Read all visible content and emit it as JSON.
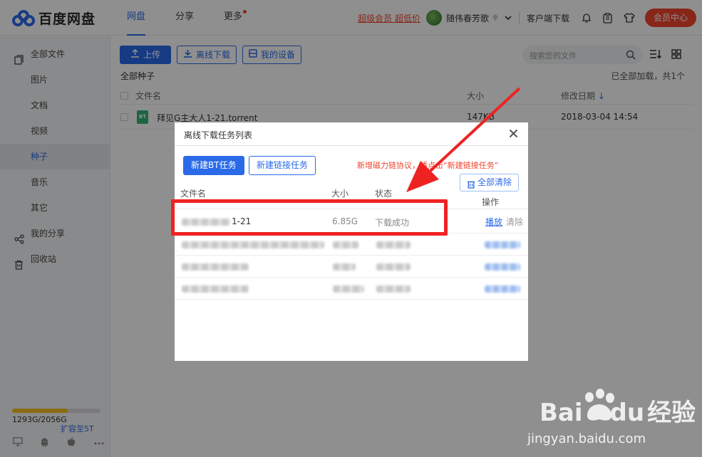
{
  "header": {
    "logo_text": "百度网盘",
    "nav": [
      {
        "label": "网盘",
        "active": true
      },
      {
        "label": "分享",
        "active": false
      },
      {
        "label": "更多",
        "active": false,
        "badge_dot": true
      }
    ],
    "vip_link": "超级会员 超低价",
    "username": "随伟春芳歌",
    "client_download": "客户端下载",
    "vip_center": "会员中心"
  },
  "sidebar": {
    "items": [
      {
        "label": "全部文件",
        "icon": "file-icon"
      },
      {
        "label": "图片"
      },
      {
        "label": "文档"
      },
      {
        "label": "视频"
      },
      {
        "label": "种子",
        "active": true
      },
      {
        "label": "音乐"
      },
      {
        "label": "其它"
      },
      {
        "label": "我的分享",
        "icon": "share-icon"
      },
      {
        "label": "回收站",
        "icon": "trash-icon"
      }
    ],
    "quota_text": "1293G/2056G",
    "quota_ratio": 0.629,
    "expand_link": "扩容至5T"
  },
  "toolbar": {
    "upload": "上传",
    "offline_download": "离线下载",
    "my_devices": "我的设备",
    "search_placeholder": "搜索您的文件"
  },
  "file_list": {
    "breadcrumb": "全部种子",
    "loaded_status": "已全部加载，共1个",
    "columns": {
      "name": "文件名",
      "size": "大小",
      "modified": "修改日期"
    },
    "rows": [
      {
        "name": "拜见G主大人1-21.torrent",
        "size": "147KB",
        "modified": "2018-03-04 14:54",
        "type_badge": "BT"
      }
    ]
  },
  "modal": {
    "title": "离线下载任务列表",
    "new_bt_task": "新建BT任务",
    "new_link_task": "新建链接任务",
    "notice": "新增磁力链协议，请点击“新建链接任务”",
    "clear_all": "全部清除",
    "columns": {
      "name": "文件名",
      "size": "大小",
      "status": "状态",
      "actions": "操作"
    },
    "tasks": [
      {
        "name_visible": "1-21",
        "size": "6.85G",
        "status": "下载成功",
        "play": "播放",
        "clear": "清除"
      }
    ]
  },
  "watermark": {
    "brand": "Bai",
    "brand_suffix": "du",
    "brand_cn": "经验",
    "url": "jingyan.baidu.com"
  },
  "colors": {
    "accent": "#2a6ae9",
    "danger": "#f0452d",
    "highlight": "#ef2222"
  }
}
